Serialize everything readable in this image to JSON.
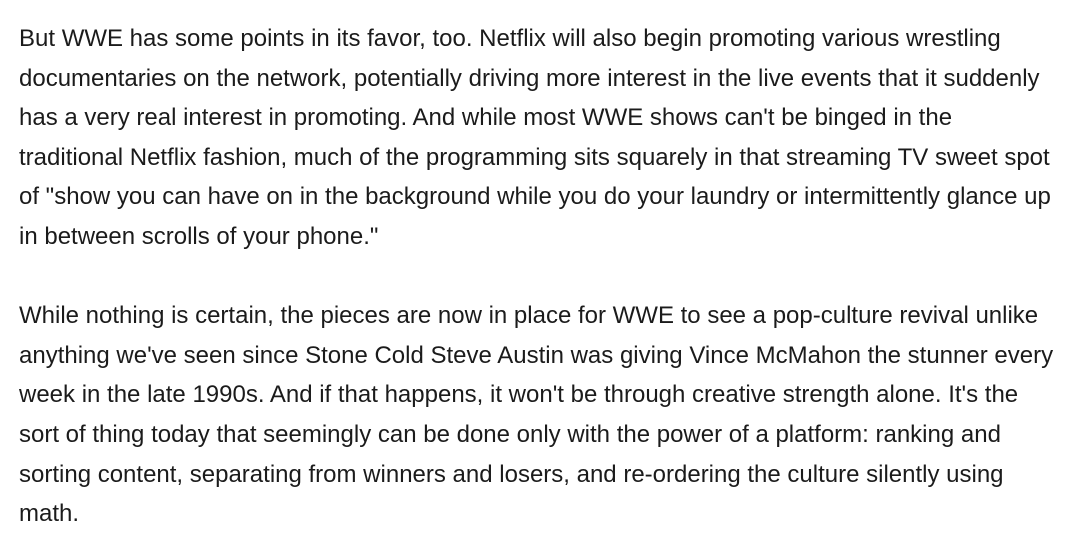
{
  "article": {
    "paragraphs": [
      "But WWE has some points in its favor, too. Netflix will also begin promoting various wrestling documentaries on the network, potentially driving more interest in the live events that it suddenly has a very real interest in promoting. And while most WWE shows can't be binged in the traditional Netflix fashion, much of the programming sits squarely in that streaming TV sweet spot of \"show you can have on in the background while you do your laundry or intermittently glance up in between scrolls of your phone.\"",
      "While nothing is certain, the pieces are now in place for WWE to see a pop-culture revival unlike anything we've seen since Stone Cold Steve Austin was giving Vince McMahon the stunner every week in the late 1990s. And if that happens, it won't be through creative strength alone. It's the sort of thing today that seemingly can be done only with the power of a platform: ranking and sorting content, separating from winners and losers, and re-ordering the culture silently using math."
    ]
  }
}
